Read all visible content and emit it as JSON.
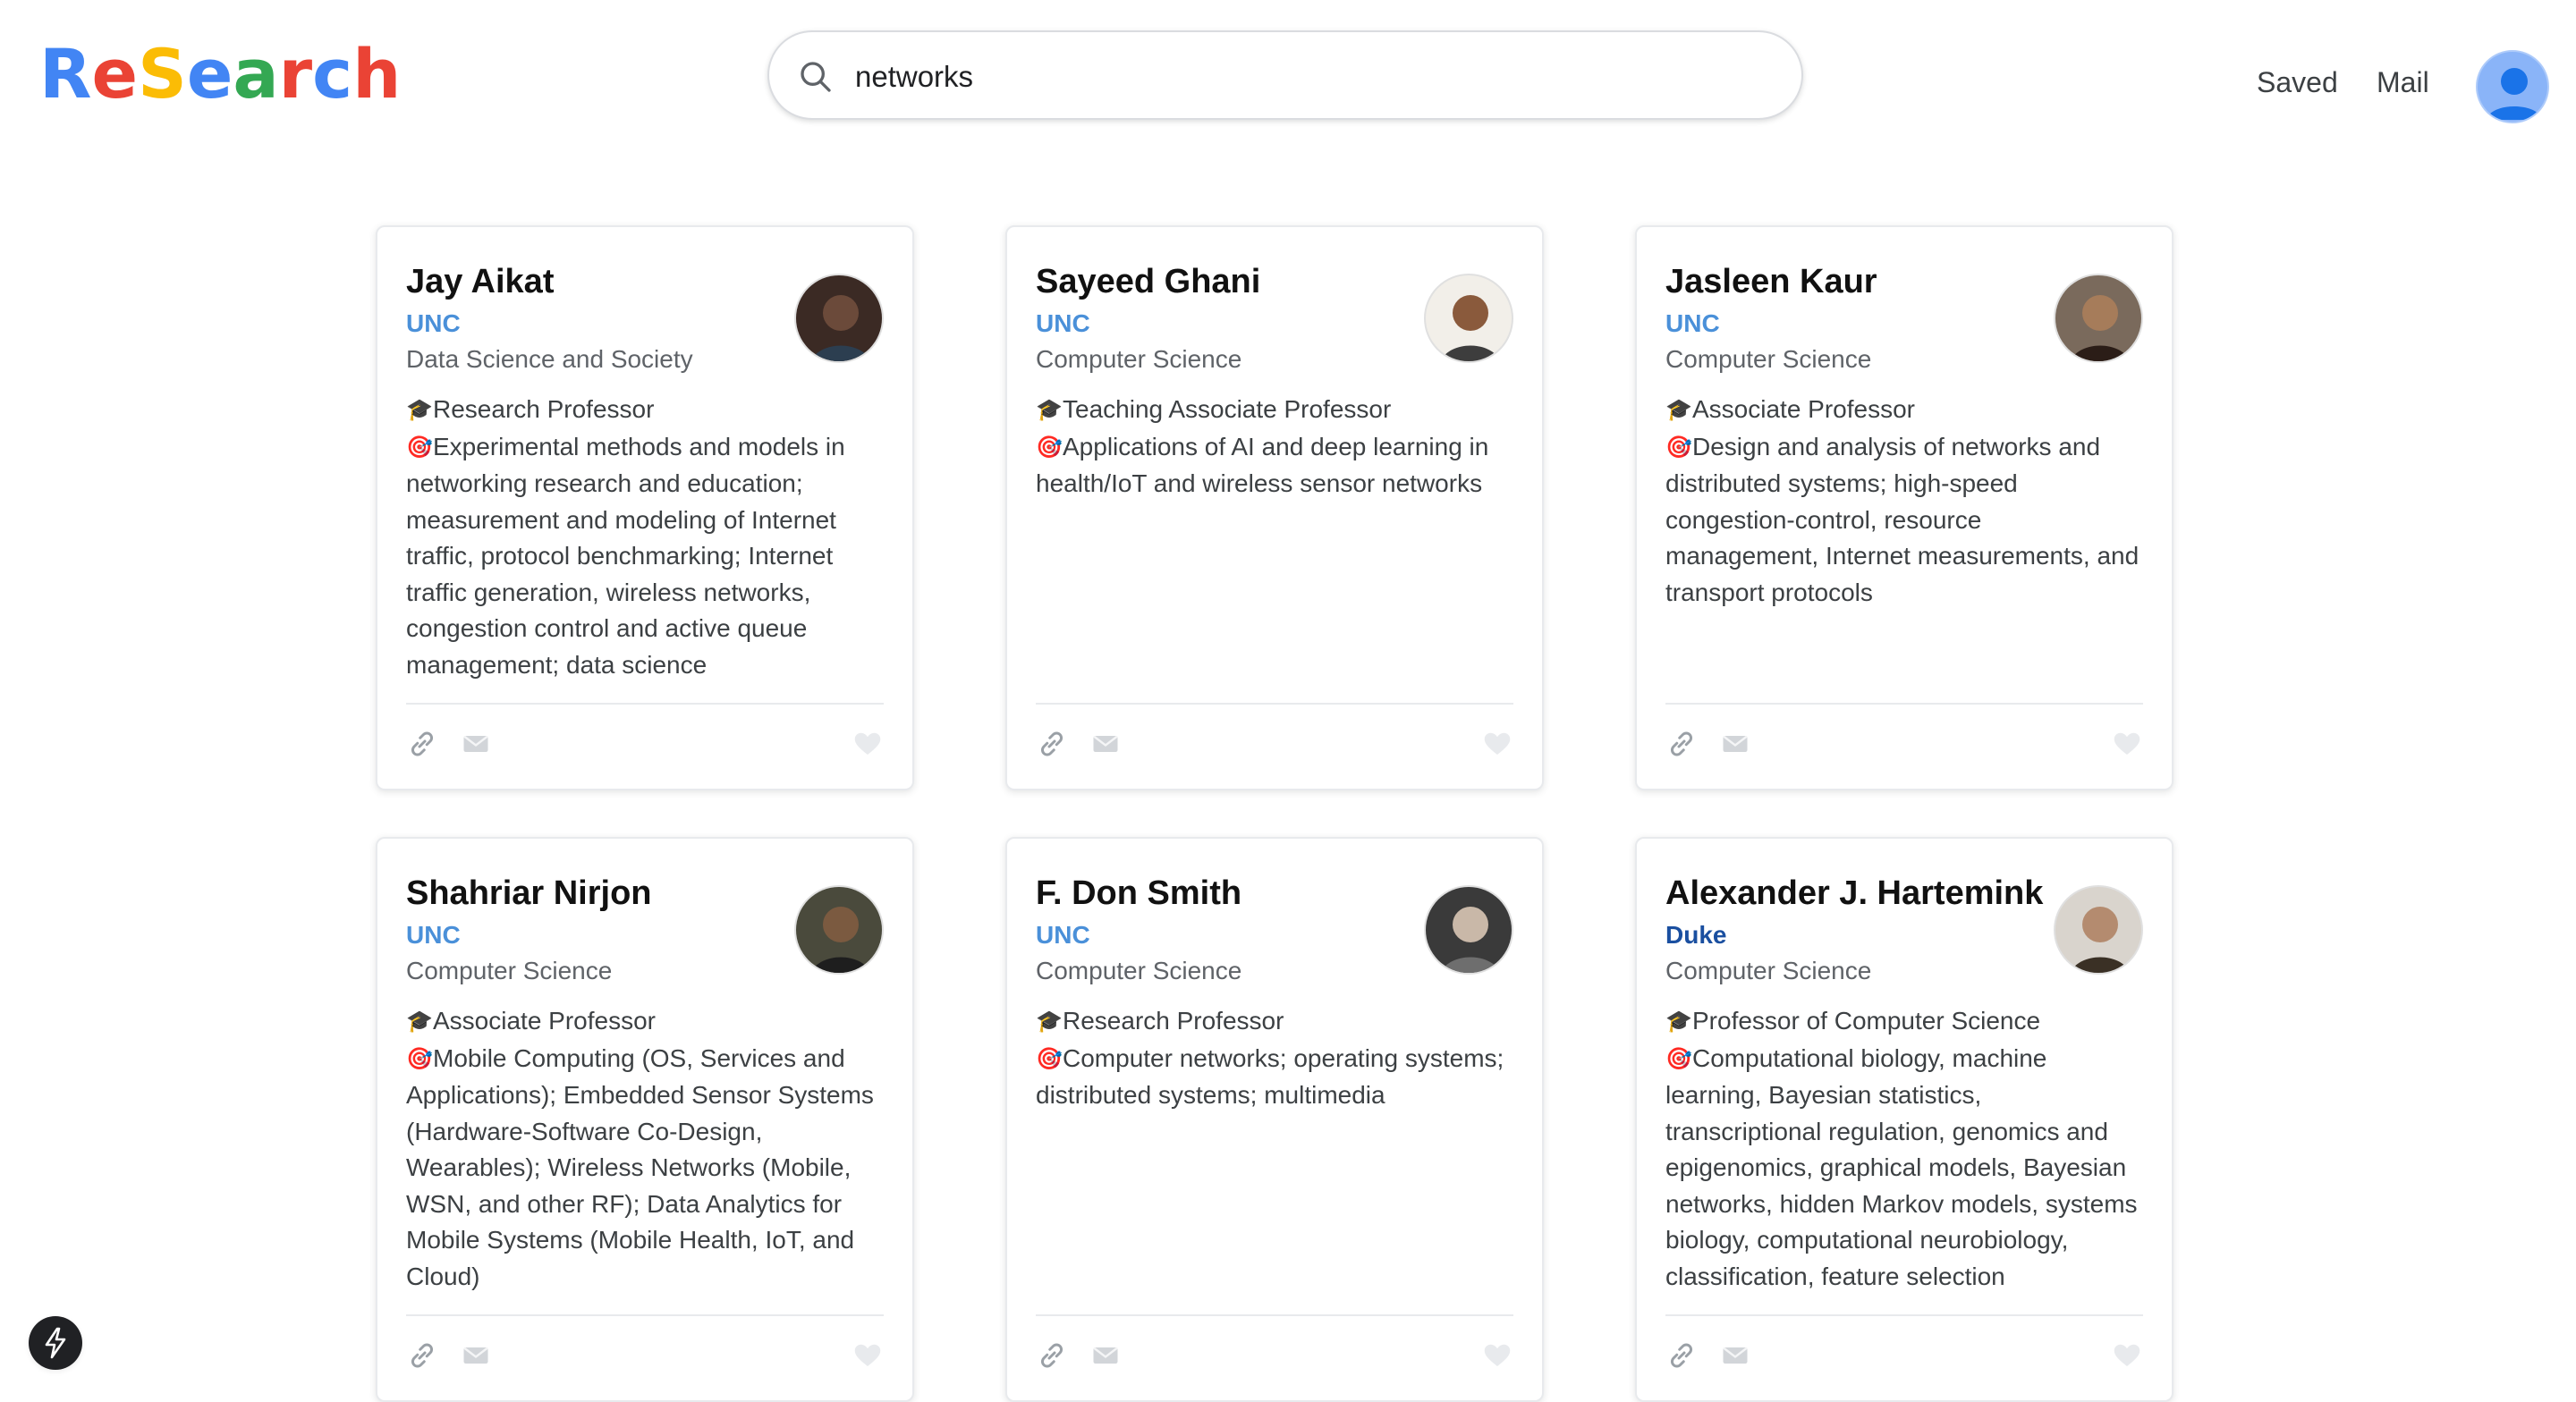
{
  "brand": {
    "letters": [
      {
        "ch": "R",
        "color": "#4285F4"
      },
      {
        "ch": "e",
        "color": "#EA4335"
      },
      {
        "ch": "S",
        "color": "#FBBC05"
      },
      {
        "ch": "e",
        "color": "#4285F4"
      },
      {
        "ch": "a",
        "color": "#34A853"
      },
      {
        "ch": "r",
        "color": "#EA4335"
      },
      {
        "ch": "c",
        "color": "#4285F4"
      },
      {
        "ch": "h",
        "color": "#EA4335"
      }
    ]
  },
  "search": {
    "value": "networks",
    "icon": "search-icon"
  },
  "nav": {
    "saved": "Saved",
    "mail": "Mail"
  },
  "cards": [
    {
      "name": "Jay Aikat",
      "institution": "UNC",
      "department": "Data Science and Society",
      "title": "Research Professor",
      "interests": [
        "Experimental methods and models in",
        "networking research and education;",
        "measurement and modeling of Internet",
        "traffic, protocol benchmarking; Internet",
        "traffic generation, wireless networks,",
        "congestion control and active queue",
        "management; data science"
      ]
    },
    {
      "name": "Sayeed Ghani",
      "institution": "UNC",
      "department": "Computer Science",
      "title": "Teaching Associate Professor",
      "interests": [
        "Applications of AI and deep learning in",
        "health/IoT and wireless sensor networks"
      ]
    },
    {
      "name": "Jasleen Kaur",
      "institution": "UNC",
      "department": "Computer Science",
      "title": "Associate Professor",
      "interests": [
        "Design and analysis of networks and",
        "distributed systems; high-speed",
        "congestion-control, resource",
        "management, Internet measurements, and",
        "transport protocols"
      ]
    },
    {
      "name": "Shahriar Nirjon",
      "institution": "UNC",
      "department": "Computer Science",
      "title": "Associate Professor",
      "interests": [
        "Mobile Computing (OS, Services and",
        "Applications); Embedded Sensor Systems",
        "(Hardware-Software Co-Design,",
        "Wearables); Wireless Networks (Mobile,",
        "WSN, and other RF); Data Analytics for",
        "Mobile Systems (Mobile Health, IoT, and",
        "Cloud)"
      ]
    },
    {
      "name": "F. Don Smith",
      "institution": "UNC",
      "department": "Computer Science",
      "title": "Research Professor",
      "interests": [
        "Computer networks; operating systems;",
        "distributed systems; multimedia"
      ]
    },
    {
      "name": "Alexander J. Hartemink",
      "institution": "Duke",
      "department": "Computer Science",
      "title": "Professor of Computer Science",
      "interests": [
        "Computational biology, machine",
        "learning, Bayesian statistics,",
        "transcriptional regulation, genomics and",
        "epigenomics, graphical models, Bayesian",
        "networks, hidden Markov models, systems",
        "biology, computational neurobiology,",
        "classification, feature selection"
      ]
    }
  ]
}
